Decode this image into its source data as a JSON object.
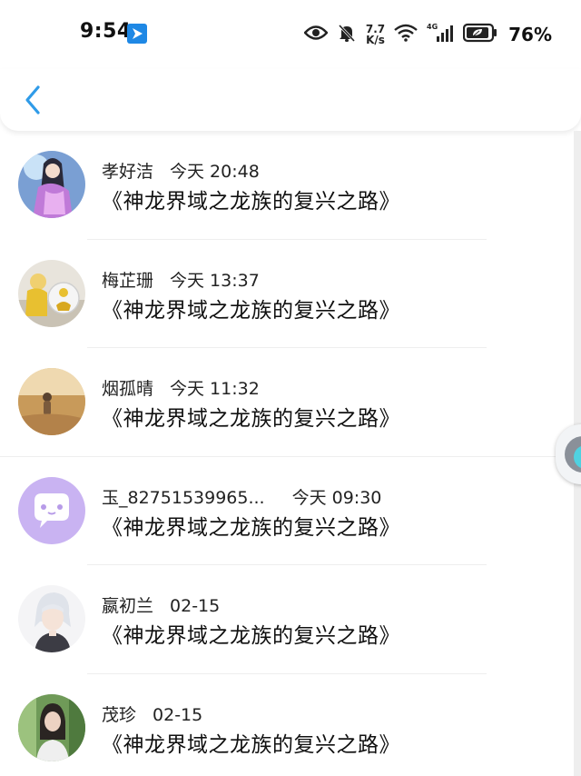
{
  "status_bar": {
    "time": "9:54",
    "net_speed_value": "7.7",
    "net_speed_unit": "K/s",
    "network_type": "4G",
    "battery_percent": "76%",
    "icons": [
      "app-notification-icon",
      "eye-icon",
      "mute-bell-icon",
      "wifi-icon",
      "cellular-signal-icon",
      "battery-leaf-icon"
    ]
  },
  "nav": {
    "back_icon": "chevron-left-icon"
  },
  "colors": {
    "accent": "#1e88e5",
    "divider": "#eeeeee",
    "text": "#111111"
  },
  "messages": [
    {
      "name": "孝好洁",
      "date": "今天 20:48",
      "text": "《神龙界域之龙族的复兴之路》"
    },
    {
      "name": "梅芷珊",
      "date": "今天 13:37",
      "text": "《神龙界域之龙族的复兴之路》"
    },
    {
      "name": "烟孤晴",
      "date": "今天 11:32",
      "text": "《神龙界域之龙族的复兴之路》"
    },
    {
      "name": "玉_82751539965...",
      "date": "今天 09:30",
      "text": "《神龙界域之龙族的复兴之路》"
    },
    {
      "name": "嬴初兰",
      "date": "02-15",
      "text": "《神龙界域之龙族的复兴之路》"
    },
    {
      "name": "茂珍",
      "date": "02-15",
      "text": "《神龙界域之龙族的复兴之路》"
    }
  ]
}
